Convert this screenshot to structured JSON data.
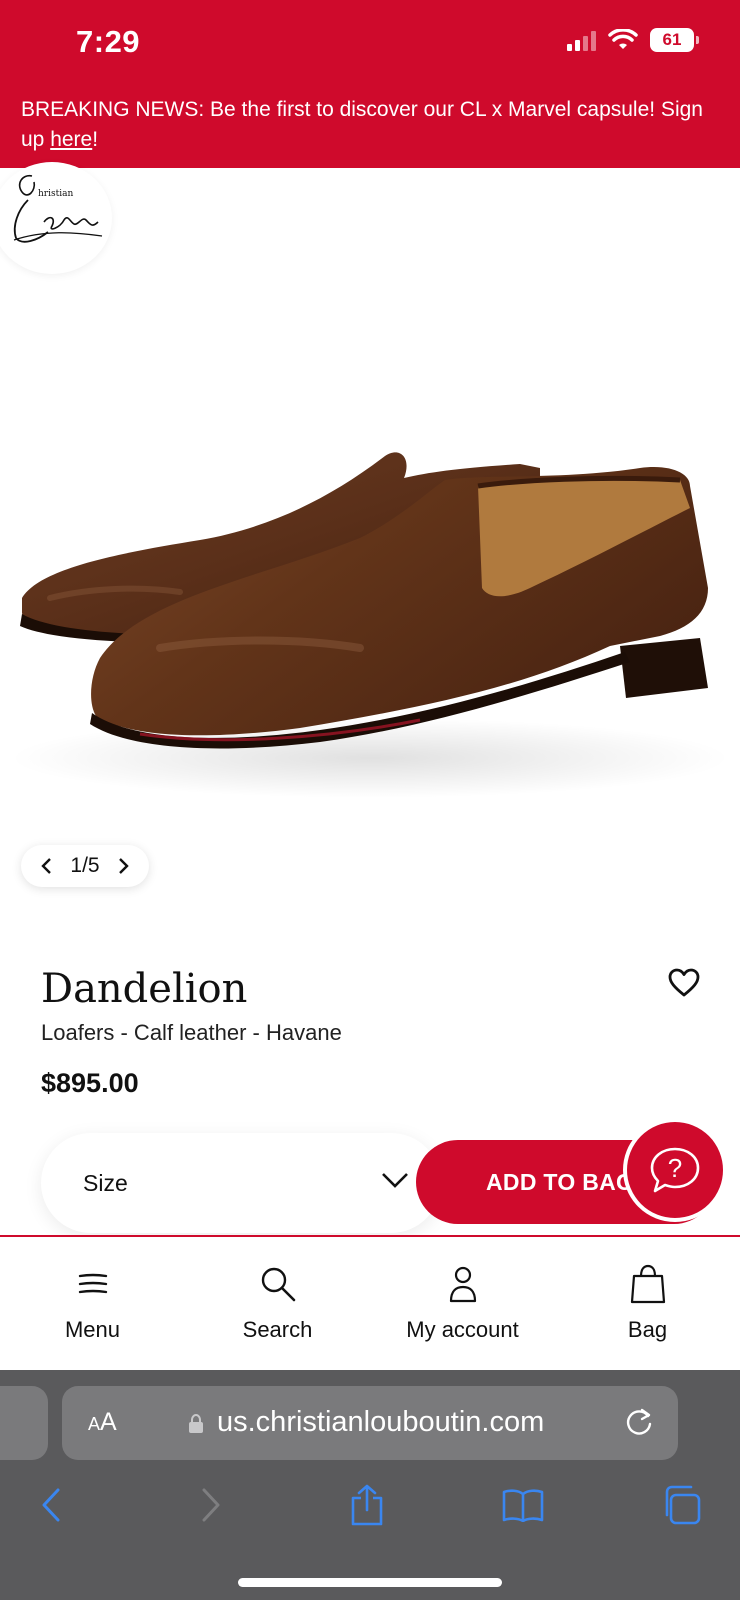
{
  "status": {
    "time": "7:29",
    "battery": "61"
  },
  "banner": {
    "text": "BREAKING NEWS: Be the first to discover our CL x Marvel capsule! Sign up ",
    "link": "here",
    "suffix": "!"
  },
  "brand": {
    "logo_text": "Christian Louboutin"
  },
  "gallery": {
    "counter": "1/5"
  },
  "product": {
    "name": "Dandelion",
    "subtitle": "Loafers - Calf leather - Havane",
    "price": "$895.00"
  },
  "actions": {
    "size_label": "Size",
    "add_to_bag": "ADD TO BAG"
  },
  "bottom_nav": {
    "items": [
      {
        "label": "Menu",
        "icon": "menu-icon"
      },
      {
        "label": "Search",
        "icon": "search-icon"
      },
      {
        "label": "My account",
        "icon": "user-icon"
      },
      {
        "label": "Bag",
        "icon": "bag-icon"
      }
    ]
  },
  "browser": {
    "aa_label": "AA",
    "url": "us.christianlouboutin.com"
  },
  "colors": {
    "brand_red": "#cf0a2c",
    "browser_gray": "#5a5a5c",
    "ios_blue": "#3a86f0"
  }
}
